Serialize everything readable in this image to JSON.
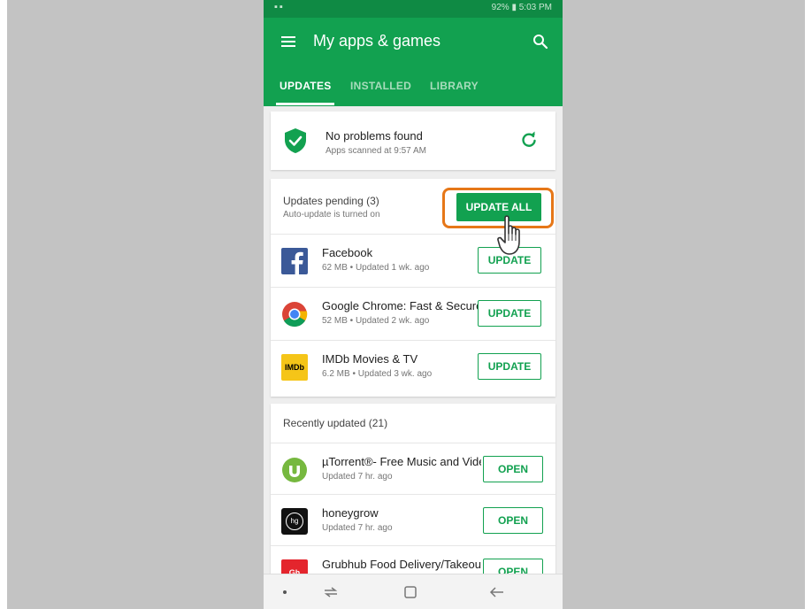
{
  "status_bar": {
    "left_icons": "▪▪",
    "right_text": "92% ▮ 5:03 PM"
  },
  "app_bar": {
    "title": "My apps & games"
  },
  "tabs": [
    {
      "label": "UPDATES",
      "active": true
    },
    {
      "label": "INSTALLED",
      "active": false
    },
    {
      "label": "LIBRARY",
      "active": false
    }
  ],
  "security": {
    "title": "No problems found",
    "subtitle": "Apps scanned at 9:57 AM"
  },
  "pending": {
    "title": "Updates pending (3)",
    "subtitle": "Auto-update is turned on",
    "update_all_label": "UPDATE ALL",
    "apps": [
      {
        "name": "Facebook",
        "meta": "62 MB • Updated 1 wk. ago",
        "button": "UPDATE",
        "icon": "facebook-icon"
      },
      {
        "name": "Google Chrome: Fast & Secure",
        "meta": "52 MB • Updated 2 wk. ago",
        "button": "UPDATE",
        "icon": "chrome-icon"
      },
      {
        "name": "IMDb Movies & TV",
        "meta": "6.2 MB • Updated 3 wk. ago",
        "button": "UPDATE",
        "icon": "imdb-icon",
        "icon_text": "IMDb"
      }
    ]
  },
  "recent": {
    "title": "Recently updated (21)",
    "apps": [
      {
        "name": "µTorrent®- Free Music and Video",
        "meta": "Updated 7 hr. ago",
        "button": "OPEN",
        "icon": "utorrent-icon"
      },
      {
        "name": "honeygrow",
        "meta": "Updated 7 hr. ago",
        "button": "OPEN",
        "icon": "honeygrow-icon",
        "icon_text": "hg"
      },
      {
        "name": "Grubhub Food Delivery/Takeout",
        "meta": "",
        "button": "OPEN",
        "icon": "grubhub-icon",
        "icon_text": "Gh"
      }
    ]
  },
  "colors": {
    "brand_green": "#12a150",
    "highlight_orange": "#e67718",
    "facebook_blue": "#3b5998",
    "imdb_yellow": "#f5c518",
    "grubhub_red": "#e4252d"
  }
}
